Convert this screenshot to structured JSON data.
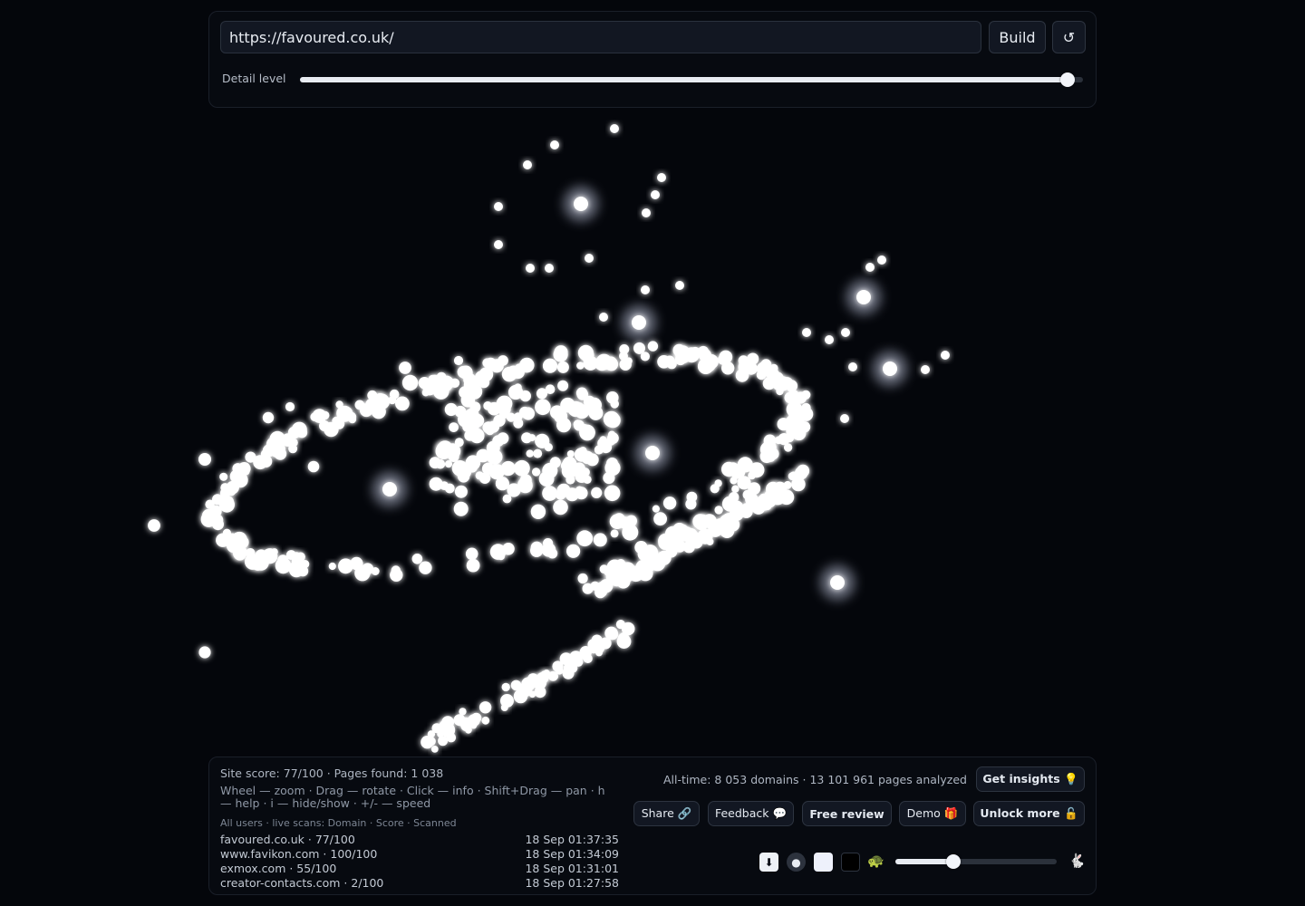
{
  "search": {
    "url_value": "https://favoured.co.uk/",
    "build_label": "Build",
    "reset_icon": "↺"
  },
  "detail": {
    "label": "Detail level",
    "value_fraction": 0.98
  },
  "viz": {
    "glow_color": "#dfe6ff"
  },
  "status": {
    "site_stats": "Site score: 77/100 · Pages found: 1 038",
    "help": "Wheel — zoom · Drag — rotate · Click — info · Shift+Drag — pan · h — help · i — hide/show · +/- — speed",
    "live_title": "All users · live scans: Domain · Score · Scanned",
    "scans": [
      {
        "domain": "favoured.co.uk · 77/100",
        "time": "18 Sep 01:37:35"
      },
      {
        "domain": "www.favikon.com · 100/100",
        "time": "18 Sep 01:34:09"
      },
      {
        "domain": "exmox.com · 55/100",
        "time": "18 Sep 01:31:01"
      },
      {
        "domain": "creator-contacts.com · 2/100",
        "time": "18 Sep 01:27:58"
      }
    ],
    "alltime": "All-time: 8 053 domains · 13 101 961 pages analyzed"
  },
  "actions": {
    "insights": "Get insights 💡",
    "share": "Share 🔗",
    "feedback": "Feedback 💬",
    "review": "Free review",
    "demo": "Demo 🎁",
    "unlock": "Unlock more 🔓"
  },
  "controls": {
    "download_icon": "⬇",
    "dot_icon": "●",
    "slow_icon": "🐢",
    "fast_icon": "🐇",
    "speed_fraction": 0.36
  }
}
